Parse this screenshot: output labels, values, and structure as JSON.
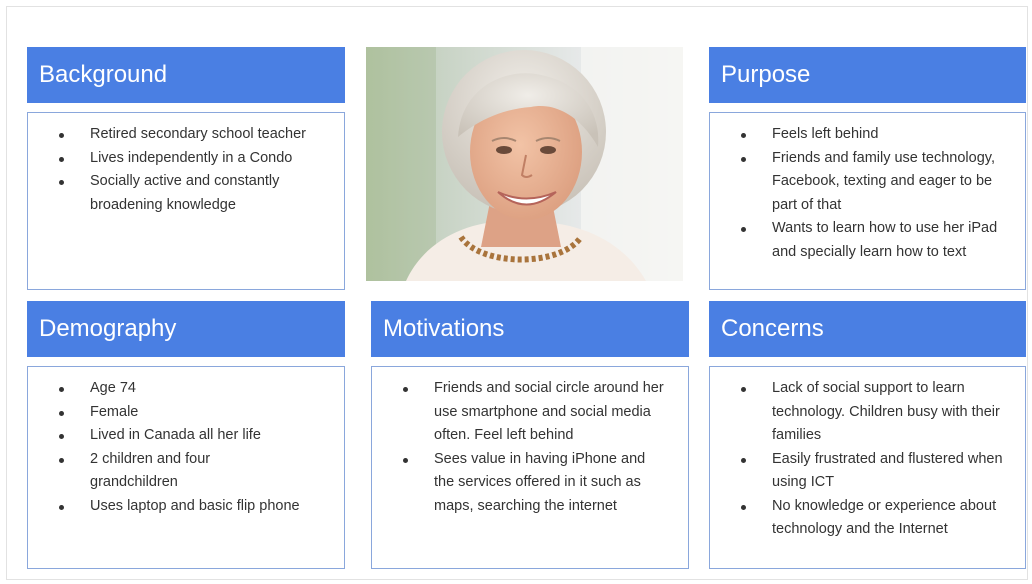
{
  "cards": {
    "background": {
      "title": "Background",
      "items": [
        "Retired secondary school teacher",
        "Lives independently in a Condo",
        "Socially active and constantly broadening knowledge"
      ]
    },
    "purpose": {
      "title": "Purpose",
      "items": [
        "Feels left behind",
        "Friends and family use technology, Facebook, texting and eager to be part of that",
        "Wants to learn how to use her iPad and specially learn how to text"
      ]
    },
    "demography": {
      "title": "Demography",
      "items": [
        "Age 74",
        "Female",
        "Lived in Canada all her life",
        "2 children and four grandchildren",
        "Uses laptop and basic flip phone"
      ]
    },
    "motivations": {
      "title": "Motivations",
      "items": [
        "Friends and social circle around her use smartphone and social media often. Feel left behind",
        "Sees value in having iPhone and the services offered in it such as maps, searching the internet"
      ]
    },
    "concerns": {
      "title": "Concerns",
      "items": [
        "Lack of social support to learn technology. Children busy with their families",
        "Easily frustrated and flustered when using ICT",
        "No knowledge or experience about technology and the Internet"
      ]
    }
  },
  "colors": {
    "header_bg": "#4a7fe3",
    "header_text": "#ffffff",
    "box_border": "#8aa7dc",
    "body_text": "#333333"
  }
}
